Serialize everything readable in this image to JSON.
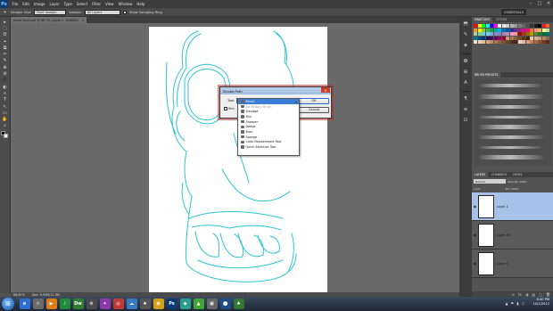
{
  "app": {
    "logo": "Ps"
  },
  "menu": [
    "File",
    "Edit",
    "Image",
    "Layer",
    "Type",
    "Select",
    "Filter",
    "View",
    "Window",
    "Help"
  ],
  "window_controls": {
    "minimize": "–",
    "maximize": "□",
    "close": "✕"
  },
  "options": {
    "sample_label": "Sample Size:",
    "sample_value": "Point Sample",
    "sample2_label": "Sample:",
    "sample2_value": "All Layers",
    "show_ring_label": "Show Sampling Ring",
    "workspace": "ESSENTIALS"
  },
  "document_tab": {
    "title": "Head Skull.psd @ 66.7% (Layer 1, RGB/8#)",
    "close": "×"
  },
  "status": {
    "zoom": "66.67%",
    "doc": "Doc: 5.93M/11.9M"
  },
  "toolbox": [
    "▸",
    "⬚",
    "ʘ",
    "⌖",
    "⧉",
    "✂",
    "✎",
    "⊕",
    "⊘",
    "⬛",
    "◐",
    "⋄",
    "T",
    "↖",
    "▭",
    "✋",
    "⌕"
  ],
  "dock_icons": [
    "⬒",
    "✎",
    "◈",
    "❂",
    "⊞",
    "A",
    "¶",
    "≡",
    "⊡"
  ],
  "panels": {
    "swatches_tabs": [
      "SWATCHES",
      "STYLES"
    ],
    "brush_tabs": [
      "BRUSH PRESETS"
    ],
    "layers_tabs": [
      "LAYERS",
      "CHANNELS",
      "PATHS"
    ],
    "blend_mode": "Normal",
    "opacity": "Opacity: 100%",
    "lock": "Lock:",
    "fill": "Fill: 100%",
    "layers": [
      {
        "name": "Layer 1",
        "selected": true
      },
      {
        "name": "Layer 38",
        "selected": false
      },
      {
        "name": "Layer 0",
        "selected": false
      }
    ],
    "footer_icons": [
      "∞",
      "fx",
      "◑",
      "▤",
      "▢",
      "🗑"
    ]
  },
  "dialog": {
    "title": "Stroke Path",
    "close": "x",
    "tool_label": "Tool:",
    "sim_label": "Sim",
    "ok": "OK",
    "cancel": "Cancel"
  },
  "dropdown": {
    "arrow": "▾",
    "items": [
      {
        "label": "Pencil",
        "state": "selected"
      },
      {
        "label": "Art History Brush",
        "state": "dim"
      },
      {
        "label": "Smudge",
        "state": "normal"
      },
      {
        "label": "Blur",
        "state": "normal"
      },
      {
        "label": "Sharpen",
        "state": "normal"
      },
      {
        "label": "Dodge",
        "state": "normal"
      },
      {
        "label": "Burn",
        "state": "normal"
      },
      {
        "label": "Sponge",
        "state": "normal"
      },
      {
        "label": "Color Replacement Tool",
        "state": "normal"
      },
      {
        "label": "Quick Selection Tool",
        "state": "normal"
      }
    ]
  },
  "taskbar": {
    "start": "⊞",
    "icons": [
      {
        "label": "e",
        "color": "#2d6fd1"
      },
      {
        "label": "☼",
        "color": "#6a6a6a"
      },
      {
        "label": "▶",
        "color": "#e07b1c"
      },
      {
        "label": "♪",
        "color": "#1f8a3a"
      },
      {
        "label": "Dw",
        "color": "#2f7d32"
      },
      {
        "label": "⚙",
        "color": "#4a4a4a"
      },
      {
        "label": "✦",
        "color": "#8a3aa8"
      },
      {
        "label": "◎",
        "color": "#c23838"
      },
      {
        "label": "☁",
        "color": "#3a7ac2"
      },
      {
        "label": "♠",
        "color": "#555555"
      },
      {
        "label": "◉",
        "color": "#d4a017"
      },
      {
        "label": "Ps",
        "color": "#0b3a75"
      },
      {
        "label": "◆",
        "color": "#2a9d8f"
      },
      {
        "label": "▲",
        "color": "#3fa535"
      },
      {
        "label": "▣",
        "color": "#666666"
      },
      {
        "label": "⬤",
        "color": "#1d4e89"
      },
      {
        "label": "♣",
        "color": "#337733"
      }
    ],
    "tray": [
      "▲",
      "⚑",
      "▮",
      "♫"
    ],
    "time": "8:40 PM",
    "date": "10/1/2012"
  }
}
